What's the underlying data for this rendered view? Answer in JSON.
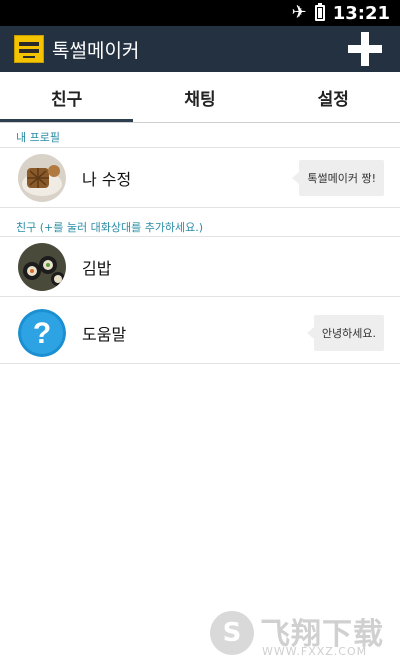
{
  "status_bar": {
    "time": "13:21"
  },
  "app_bar": {
    "title": "톡썰메이커"
  },
  "tabs": [
    {
      "label": "친구",
      "active": true
    },
    {
      "label": "채팅",
      "active": false
    },
    {
      "label": "설정",
      "active": false
    }
  ],
  "my_profile": {
    "section_label": "내 프로필",
    "name": "나 수정",
    "status_message": "톡썰메이커 짱!"
  },
  "friends": {
    "section_label": "친구 (+를 눌러 대화상대를 추가하세요.)",
    "items": [
      {
        "name": "김밥",
        "status_message": ""
      },
      {
        "name": "도움말",
        "status_message": "안녕하세요."
      }
    ]
  },
  "watermark": {
    "brand": "飞翔下载",
    "domain": "WWW.FXXZ.COM"
  },
  "colors": {
    "app_bar_bg": "#233140",
    "accent_label": "#2a8da6",
    "help_icon": "#1a8fd1",
    "logo_yellow": "#f5c400"
  },
  "icons": [
    "airplane-icon",
    "battery-icon",
    "app-logo-icon",
    "add-icon",
    "help-question-icon"
  ]
}
